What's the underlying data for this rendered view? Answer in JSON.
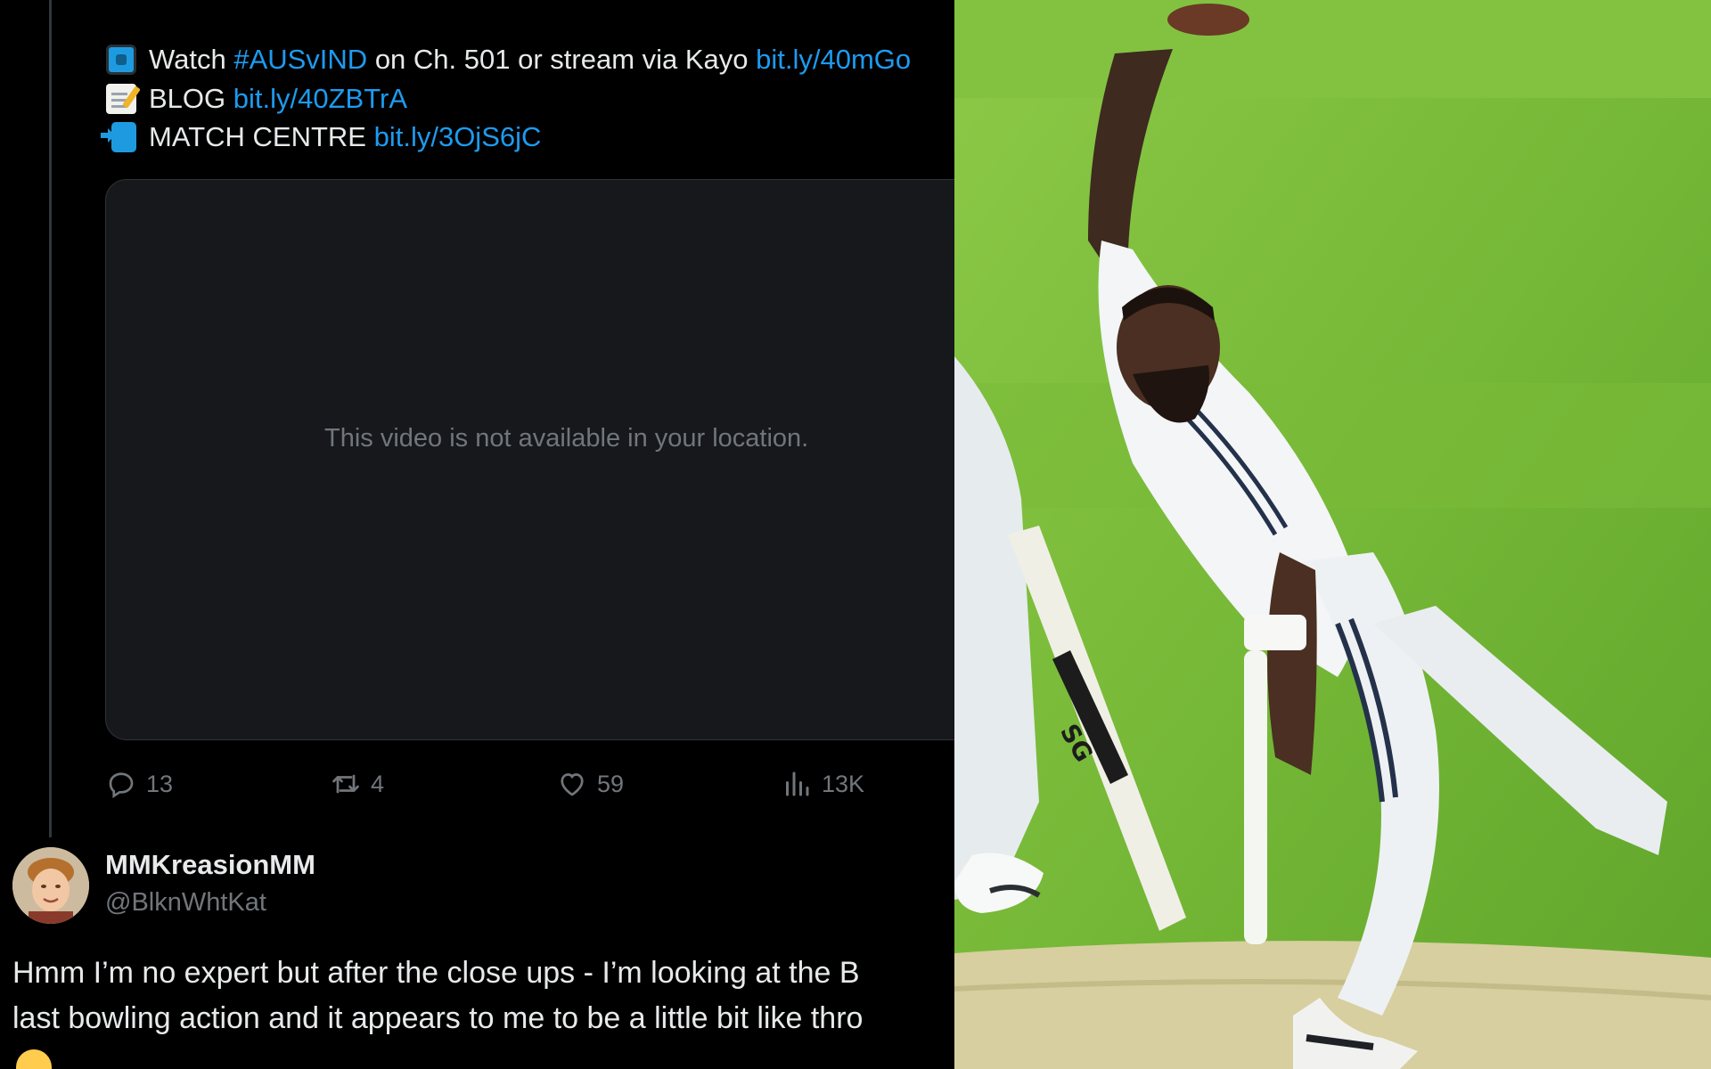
{
  "tweet": {
    "line1": {
      "emoji": "tv-icon",
      "text_a": "Watch ",
      "hashtag": "#AUSvIND",
      "text_b": " on Ch. 501 or stream via Kayo ",
      "link": "bit.ly/40mGo"
    },
    "line2": {
      "emoji": "memo-icon",
      "text": "BLOG ",
      "link": "bit.ly/40ZBTrA"
    },
    "line3": {
      "emoji": "mobile-arrow-icon",
      "text": "MATCH CENTRE ",
      "link": "bit.ly/3OjS6jC"
    },
    "video_message": "This video is not available in your location.",
    "actions": {
      "replies": "13",
      "reposts": "4",
      "likes": "59",
      "views": "13K"
    }
  },
  "reply": {
    "display_name": "MMKreasionMM",
    "handle": "@BlknWhtKat",
    "line1": "Hmm I’m no expert but after the close ups - I’m looking at the B",
    "line2": "last bowling action and it appears to me to be a little bit like thro",
    "emoji": "laughing-face-icon"
  },
  "photo": {
    "bat_brand": "SG"
  },
  "colors": {
    "background": "#000000",
    "link": "#1d9bf0",
    "muted_text": "#71767b",
    "card": "#16181c",
    "pitch_green": "#7fbf3a"
  }
}
